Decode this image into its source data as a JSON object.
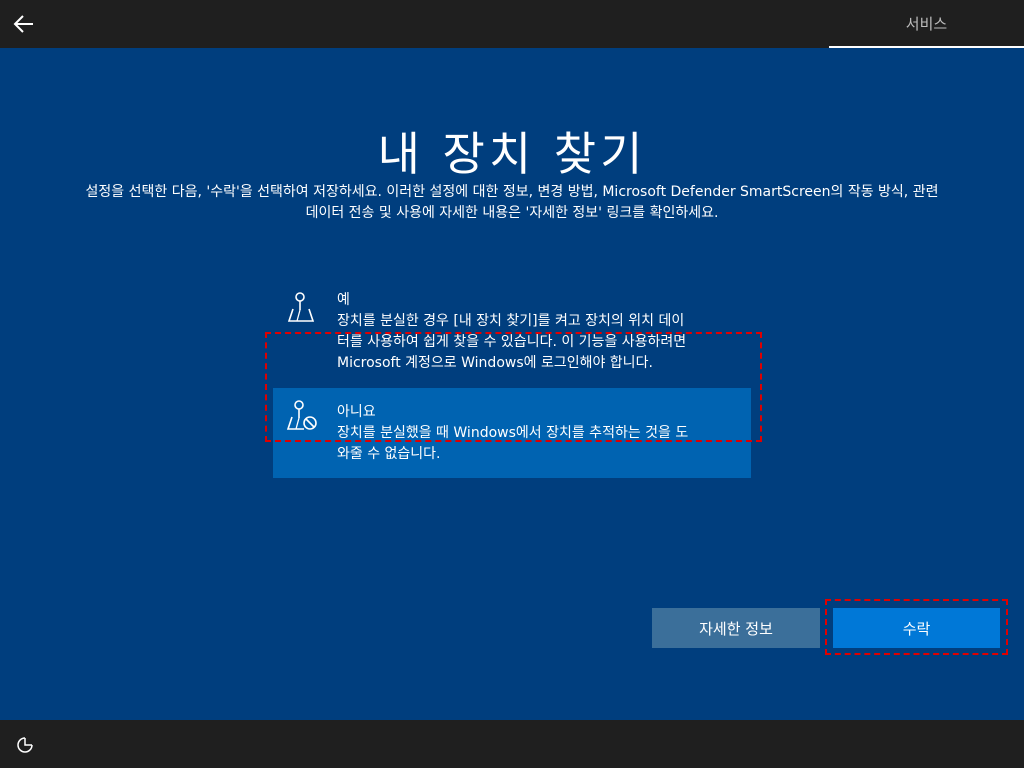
{
  "header": {
    "back_icon": "back-arrow-icon",
    "section_label": "서비스"
  },
  "main": {
    "title": "내 장치 찾기",
    "description_line1": "설정을 선택한 다음, '수락'을 선택하여 저장하세요. 이러한 설정에 대한 정보, 변경 방법, Microsoft Defender SmartScreen의 작동 방식, 관련",
    "description_line2": "데이터 전송 및 사용에 자세한 내용은 '자세한 정보' 링크를 확인하세요."
  },
  "options": [
    {
      "icon": "location-map-icon",
      "title": "예",
      "desc_lines": [
        "장치를 분실한 경우 [내 장치 찾기]를 켜고 장치의 위치 데이",
        "터를 사용하여 쉽게 찾을 수 있습니다. 이 기능을 사용하려면",
        "Microsoft 계정으로 Windows에 로그인해야 합니다."
      ],
      "selected": false
    },
    {
      "icon": "location-blocked-icon",
      "title": "아니요",
      "desc_lines": [
        "장치를 분실했을 때 Windows에서 장치를 추적하는 것을 도",
        "와줄 수 없습니다."
      ],
      "selected": true
    }
  ],
  "buttons": {
    "learn_more": "자세한 정보",
    "accept": "수락"
  },
  "footer": {
    "ease_icon": "ease-of-access-icon"
  },
  "colors": {
    "background": "#003e7e",
    "selected_option": "#0063b1",
    "accept_button": "#0078d7",
    "learn_button": "#3b6f9a",
    "highlight_dash": "#e00000"
  }
}
